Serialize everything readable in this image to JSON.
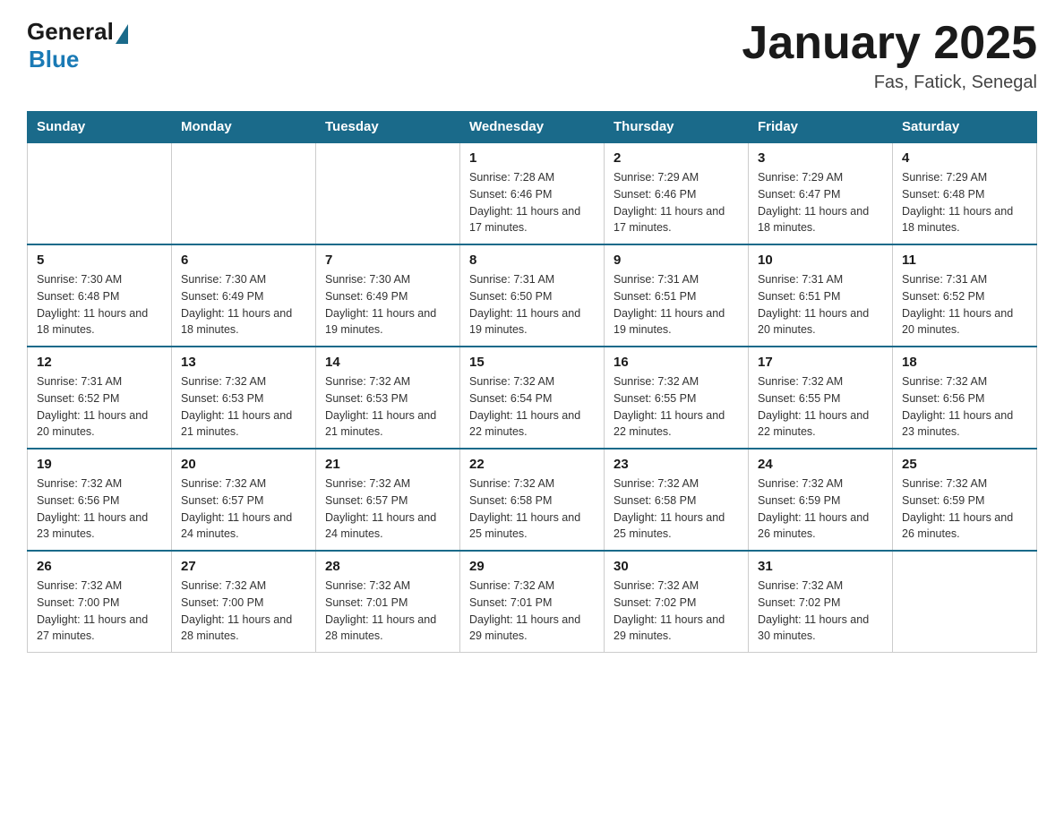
{
  "header": {
    "logo_general": "General",
    "logo_blue": "Blue",
    "title": "January 2025",
    "subtitle": "Fas, Fatick, Senegal"
  },
  "days": [
    "Sunday",
    "Monday",
    "Tuesday",
    "Wednesday",
    "Thursday",
    "Friday",
    "Saturday"
  ],
  "weeks": [
    [
      {
        "day": "",
        "info": ""
      },
      {
        "day": "",
        "info": ""
      },
      {
        "day": "",
        "info": ""
      },
      {
        "day": "1",
        "info": "Sunrise: 7:28 AM\nSunset: 6:46 PM\nDaylight: 11 hours and 17 minutes."
      },
      {
        "day": "2",
        "info": "Sunrise: 7:29 AM\nSunset: 6:46 PM\nDaylight: 11 hours and 17 minutes."
      },
      {
        "day": "3",
        "info": "Sunrise: 7:29 AM\nSunset: 6:47 PM\nDaylight: 11 hours and 18 minutes."
      },
      {
        "day": "4",
        "info": "Sunrise: 7:29 AM\nSunset: 6:48 PM\nDaylight: 11 hours and 18 minutes."
      }
    ],
    [
      {
        "day": "5",
        "info": "Sunrise: 7:30 AM\nSunset: 6:48 PM\nDaylight: 11 hours and 18 minutes."
      },
      {
        "day": "6",
        "info": "Sunrise: 7:30 AM\nSunset: 6:49 PM\nDaylight: 11 hours and 18 minutes."
      },
      {
        "day": "7",
        "info": "Sunrise: 7:30 AM\nSunset: 6:49 PM\nDaylight: 11 hours and 19 minutes."
      },
      {
        "day": "8",
        "info": "Sunrise: 7:31 AM\nSunset: 6:50 PM\nDaylight: 11 hours and 19 minutes."
      },
      {
        "day": "9",
        "info": "Sunrise: 7:31 AM\nSunset: 6:51 PM\nDaylight: 11 hours and 19 minutes."
      },
      {
        "day": "10",
        "info": "Sunrise: 7:31 AM\nSunset: 6:51 PM\nDaylight: 11 hours and 20 minutes."
      },
      {
        "day": "11",
        "info": "Sunrise: 7:31 AM\nSunset: 6:52 PM\nDaylight: 11 hours and 20 minutes."
      }
    ],
    [
      {
        "day": "12",
        "info": "Sunrise: 7:31 AM\nSunset: 6:52 PM\nDaylight: 11 hours and 20 minutes."
      },
      {
        "day": "13",
        "info": "Sunrise: 7:32 AM\nSunset: 6:53 PM\nDaylight: 11 hours and 21 minutes."
      },
      {
        "day": "14",
        "info": "Sunrise: 7:32 AM\nSunset: 6:53 PM\nDaylight: 11 hours and 21 minutes."
      },
      {
        "day": "15",
        "info": "Sunrise: 7:32 AM\nSunset: 6:54 PM\nDaylight: 11 hours and 22 minutes."
      },
      {
        "day": "16",
        "info": "Sunrise: 7:32 AM\nSunset: 6:55 PM\nDaylight: 11 hours and 22 minutes."
      },
      {
        "day": "17",
        "info": "Sunrise: 7:32 AM\nSunset: 6:55 PM\nDaylight: 11 hours and 22 minutes."
      },
      {
        "day": "18",
        "info": "Sunrise: 7:32 AM\nSunset: 6:56 PM\nDaylight: 11 hours and 23 minutes."
      }
    ],
    [
      {
        "day": "19",
        "info": "Sunrise: 7:32 AM\nSunset: 6:56 PM\nDaylight: 11 hours and 23 minutes."
      },
      {
        "day": "20",
        "info": "Sunrise: 7:32 AM\nSunset: 6:57 PM\nDaylight: 11 hours and 24 minutes."
      },
      {
        "day": "21",
        "info": "Sunrise: 7:32 AM\nSunset: 6:57 PM\nDaylight: 11 hours and 24 minutes."
      },
      {
        "day": "22",
        "info": "Sunrise: 7:32 AM\nSunset: 6:58 PM\nDaylight: 11 hours and 25 minutes."
      },
      {
        "day": "23",
        "info": "Sunrise: 7:32 AM\nSunset: 6:58 PM\nDaylight: 11 hours and 25 minutes."
      },
      {
        "day": "24",
        "info": "Sunrise: 7:32 AM\nSunset: 6:59 PM\nDaylight: 11 hours and 26 minutes."
      },
      {
        "day": "25",
        "info": "Sunrise: 7:32 AM\nSunset: 6:59 PM\nDaylight: 11 hours and 26 minutes."
      }
    ],
    [
      {
        "day": "26",
        "info": "Sunrise: 7:32 AM\nSunset: 7:00 PM\nDaylight: 11 hours and 27 minutes."
      },
      {
        "day": "27",
        "info": "Sunrise: 7:32 AM\nSunset: 7:00 PM\nDaylight: 11 hours and 28 minutes."
      },
      {
        "day": "28",
        "info": "Sunrise: 7:32 AM\nSunset: 7:01 PM\nDaylight: 11 hours and 28 minutes."
      },
      {
        "day": "29",
        "info": "Sunrise: 7:32 AM\nSunset: 7:01 PM\nDaylight: 11 hours and 29 minutes."
      },
      {
        "day": "30",
        "info": "Sunrise: 7:32 AM\nSunset: 7:02 PM\nDaylight: 11 hours and 29 minutes."
      },
      {
        "day": "31",
        "info": "Sunrise: 7:32 AM\nSunset: 7:02 PM\nDaylight: 11 hours and 30 minutes."
      },
      {
        "day": "",
        "info": ""
      }
    ]
  ]
}
